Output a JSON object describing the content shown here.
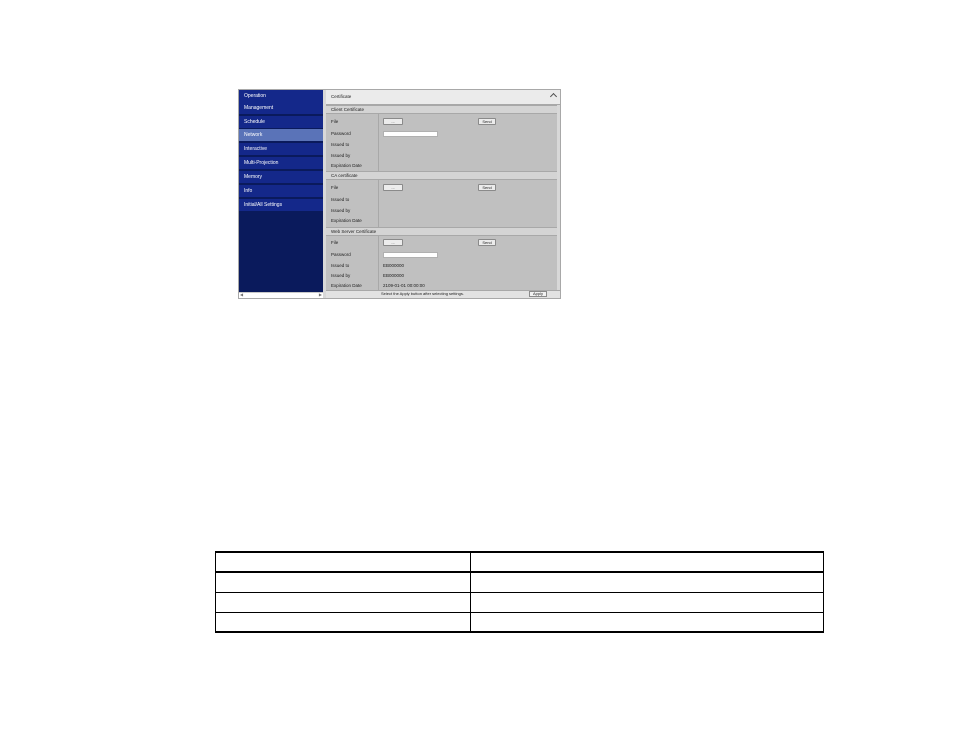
{
  "sidebar": {
    "items": [
      {
        "label": "Operation",
        "active": false
      },
      {
        "label": "Management",
        "active": false
      },
      {
        "label": "Schedule",
        "active": false
      },
      {
        "label": "Network",
        "active": true
      },
      {
        "label": "Interactive",
        "active": false
      },
      {
        "label": "Multi-Projection",
        "active": false
      },
      {
        "label": "Memory",
        "active": false
      },
      {
        "label": "Info",
        "active": false
      },
      {
        "label": "Initial/All Settings",
        "active": false
      }
    ]
  },
  "panel": {
    "title": "Certificate",
    "sections": [
      {
        "title": "Client Certificate",
        "rows": [
          {
            "label": "File",
            "browse": "...",
            "send": "Send"
          },
          {
            "label": "Password",
            "password_value": ""
          },
          {
            "label": "Issued to",
            "value": ""
          },
          {
            "label": "Issued by",
            "value": ""
          },
          {
            "label": "Expiration Date",
            "value": ""
          }
        ]
      },
      {
        "title": "CA certificate",
        "rows": [
          {
            "label": "File",
            "browse": "...",
            "send": "Send"
          },
          {
            "label": "Issued to",
            "value": ""
          },
          {
            "label": "Issued by",
            "value": ""
          },
          {
            "label": "Expiration Date",
            "value": ""
          }
        ]
      },
      {
        "title": "Web Server Certificate",
        "rows": [
          {
            "label": "File",
            "browse": "...",
            "send": "Send"
          },
          {
            "label": "Password",
            "password_value": ""
          },
          {
            "label": "Issued to",
            "value": "EB000000"
          },
          {
            "label": "Issued by",
            "value": "EB000000"
          },
          {
            "label": "Expiration Date",
            "value": "2109-01-01 00:00:00"
          }
        ]
      }
    ],
    "footer_message": "Select the Apply button after selecting settings.",
    "apply_label": "Apply"
  },
  "table": {
    "rows": [
      [
        "",
        ""
      ],
      [
        "",
        ""
      ],
      [
        "",
        ""
      ],
      [
        "",
        ""
      ]
    ]
  },
  "colors": {
    "sidebar_bg": "#0a1a5c",
    "nav_item": "#14288a",
    "nav_active": "#5a73b8",
    "panel_bg": "#c0c0c0"
  }
}
